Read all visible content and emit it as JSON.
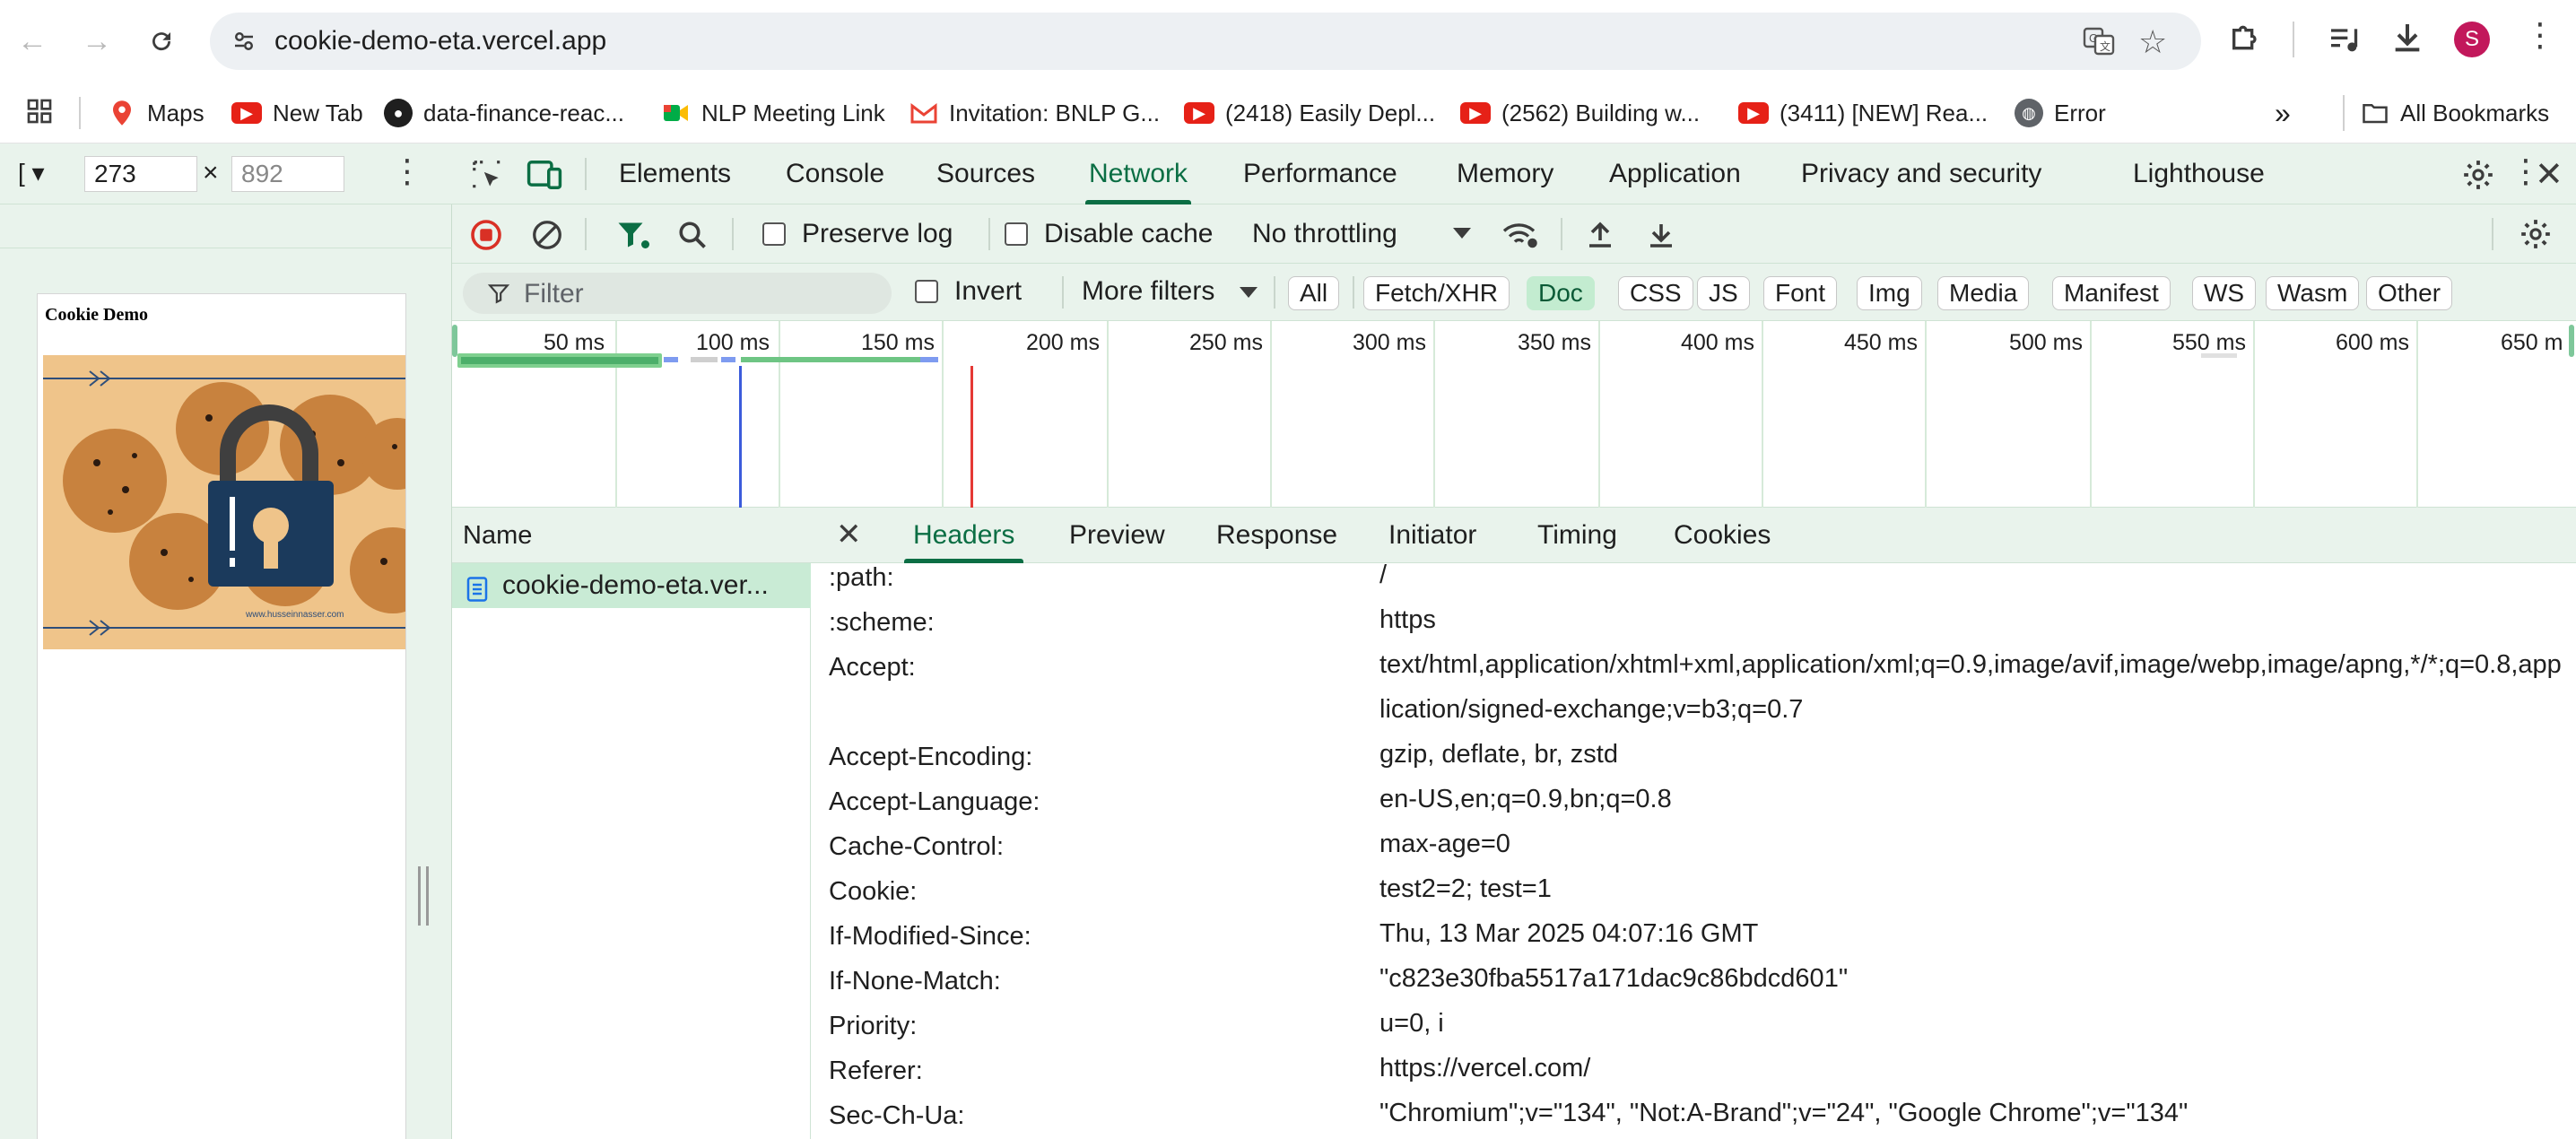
{
  "browser": {
    "url": "cookie-demo-eta.vercel.app",
    "profile_initial": "S"
  },
  "bookmarks": {
    "items": [
      {
        "label": "Maps",
        "icon": "maps-pin-icon"
      },
      {
        "label": "New Tab",
        "icon": "youtube-icon"
      },
      {
        "label": "data-finance-reac...",
        "icon": "github-icon"
      },
      {
        "label": "NLP Meeting Link",
        "icon": "meet-icon"
      },
      {
        "label": "Invitation: BNLP G...",
        "icon": "gmail-icon"
      },
      {
        "label": "(2418) Easily Depl...",
        "icon": "youtube-icon"
      },
      {
        "label": "(2562) Building w...",
        "icon": "youtube-icon"
      },
      {
        "label": "(3411) [NEW] Rea...",
        "icon": "youtube-icon"
      },
      {
        "label": "Error",
        "icon": "globe-icon"
      }
    ],
    "all_bookmarks": "All Bookmarks"
  },
  "device": {
    "width": "273",
    "height": "892",
    "page_title": "Cookie Demo",
    "image_footer": "www.husseinnasser.com"
  },
  "devtools": {
    "tabs": [
      "Elements",
      "Console",
      "Sources",
      "Network",
      "Performance",
      "Memory",
      "Application",
      "Privacy and security",
      "Lighthouse"
    ],
    "active_tab": "Network",
    "preserve_log": "Preserve log",
    "disable_cache": "Disable cache",
    "throttling": "No throttling",
    "filter_placeholder": "Filter",
    "invert": "Invert",
    "more_filters": "More filters",
    "type_filters": [
      "All",
      "Fetch/XHR",
      "Doc",
      "CSS",
      "JS",
      "Font",
      "Img",
      "Media",
      "Manifest",
      "WS",
      "Wasm",
      "Other"
    ],
    "active_filter": "Doc",
    "timeline_ticks": [
      "50 ms",
      "100 ms",
      "150 ms",
      "200 ms",
      "250 ms",
      "300 ms",
      "350 ms",
      "400 ms",
      "450 ms",
      "500 ms",
      "550 ms",
      "600 ms",
      "650 m"
    ],
    "name_header": "Name",
    "request_name": "cookie-demo-eta.ver...",
    "detail_tabs": [
      "Headers",
      "Preview",
      "Response",
      "Initiator",
      "Timing",
      "Cookies"
    ],
    "active_detail_tab": "Headers",
    "headers": [
      {
        "name": ":path:",
        "value": "/"
      },
      {
        "name": ":scheme:",
        "value": "https"
      },
      {
        "name": "Accept:",
        "value": "text/html,application/xhtml+xml,application/xml;q=0.9,image/avif,image/webp,image/apng,*/*;q=0.8,application/signed-exchange;v=b3;q=0.7"
      },
      {
        "name": "Accept-Encoding:",
        "value": "gzip, deflate, br, zstd"
      },
      {
        "name": "Accept-Language:",
        "value": "en-US,en;q=0.9,bn;q=0.8"
      },
      {
        "name": "Cache-Control:",
        "value": "max-age=0"
      },
      {
        "name": "Cookie:",
        "value": "test2=2; test=1"
      },
      {
        "name": "If-Modified-Since:",
        "value": "Thu, 13 Mar 2025 04:07:16 GMT"
      },
      {
        "name": "If-None-Match:",
        "value": "\"c823e30fba5517a171dac9c86bdcd601\""
      },
      {
        "name": "Priority:",
        "value": "u=0, i"
      },
      {
        "name": "Referer:",
        "value": "https://vercel.com/"
      },
      {
        "name": "Sec-Ch-Ua:",
        "value": "\"Chromium\";v=\"134\", \"Not:A-Brand\";v=\"24\", \"Google Chrome\";v=\"134\""
      }
    ]
  },
  "colors": {
    "accent": "#0b6e44",
    "record": "#d93025",
    "panel_bg": "#e9f3ec"
  }
}
